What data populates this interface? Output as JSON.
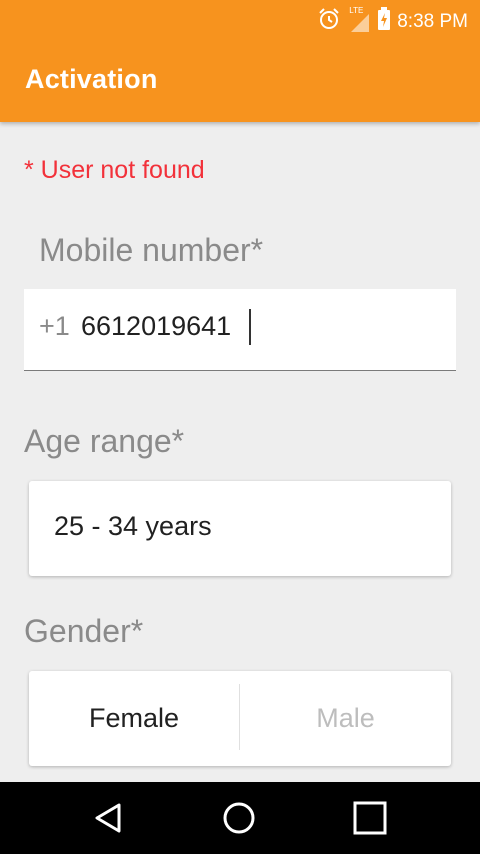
{
  "status_bar": {
    "time": "8:38 PM",
    "network": "LTE",
    "icons": [
      "alarm-icon",
      "signal-icon",
      "battery-charging-icon"
    ]
  },
  "app_bar": {
    "title": "Activation",
    "color": "#F7931E"
  },
  "form": {
    "error_message": "* User not found",
    "error_color": "#F2313A",
    "mobile": {
      "label": "Mobile number*",
      "prefix": "+1",
      "value": "6612019641"
    },
    "age": {
      "label": "Age range*",
      "selected": "25 - 34 years"
    },
    "gender": {
      "label": "Gender*",
      "options": [
        "Female",
        "Male"
      ],
      "selected": "Female"
    }
  },
  "nav_bar": {
    "icons": [
      "back-icon",
      "home-icon",
      "recents-icon"
    ]
  }
}
